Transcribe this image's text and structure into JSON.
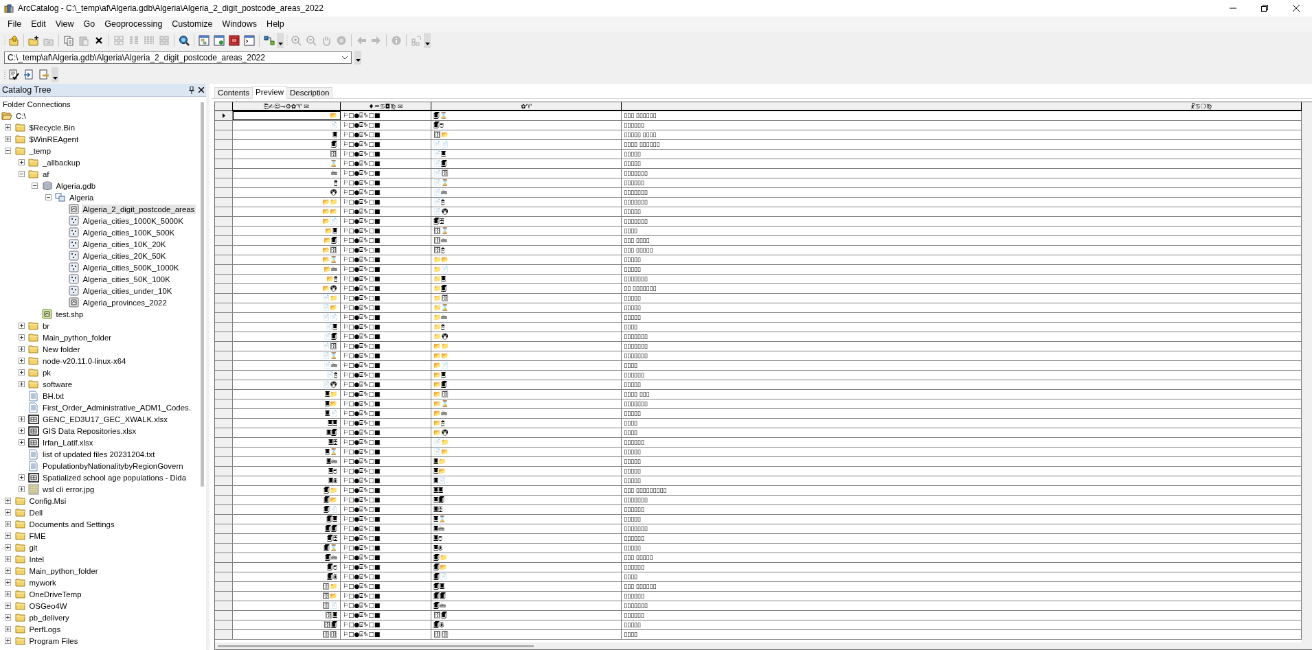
{
  "window": {
    "title": "ArcCatalog - C:\\_temp\\af\\Algeria.gdb\\Algeria\\Algeria_2_digit_postcode_areas_2022"
  },
  "menu": [
    "File",
    "Edit",
    "View",
    "Go",
    "Geoprocessing",
    "Customize",
    "Windows",
    "Help"
  ],
  "location": {
    "value": "C:\\_temp\\af\\Algeria.gdb\\Algeria\\Algeria_2_digit_postcode_areas_2022"
  },
  "catalog_tree": {
    "title": "Catalog Tree",
    "items": [
      {
        "label": "Folder Connections",
        "kind": "connections",
        "selected": false
      },
      {
        "label": "C:\\",
        "kind": "drive",
        "selected": false,
        "children": [
          {
            "label": "$Recycle.Bin",
            "kind": "folder",
            "expanded": false,
            "selected": false
          },
          {
            "label": "$WinREAgent",
            "kind": "folder",
            "expanded": false,
            "selected": false
          },
          {
            "label": "_temp",
            "kind": "folder",
            "expanded": true,
            "selected": false,
            "children": [
              {
                "label": "_allbackup",
                "kind": "folder",
                "expanded": false,
                "selected": false
              },
              {
                "label": "af",
                "kind": "folder",
                "expanded": true,
                "selected": false,
                "children": [
                  {
                    "label": "Algeria.gdb",
                    "kind": "geodatabase",
                    "expanded": true,
                    "selected": false,
                    "children": [
                      {
                        "label": "Algeria",
                        "kind": "dataset",
                        "expanded": true,
                        "selected": false,
                        "children": [
                          {
                            "label": "Algeria_2_digit_postcode_areas",
                            "kind": "polygon",
                            "selected": true
                          },
                          {
                            "label": "Algeria_cities_1000K_5000K",
                            "kind": "point",
                            "selected": false
                          },
                          {
                            "label": "Algeria_cities_100K_500K",
                            "kind": "point",
                            "selected": false
                          },
                          {
                            "label": "Algeria_cities_10K_20K",
                            "kind": "point",
                            "selected": false
                          },
                          {
                            "label": "Algeria_cities_20K_50K",
                            "kind": "point",
                            "selected": false
                          },
                          {
                            "label": "Algeria_cities_500K_1000K",
                            "kind": "point",
                            "selected": false
                          },
                          {
                            "label": "Algeria_cities_50K_100K",
                            "kind": "point",
                            "selected": false
                          },
                          {
                            "label": "Algeria_cities_under_10K",
                            "kind": "point",
                            "selected": false
                          },
                          {
                            "label": "Algeria_provinces_2022",
                            "kind": "polygon",
                            "selected": false
                          }
                        ]
                      }
                    ]
                  },
                  {
                    "label": "test.shp",
                    "kind": "shapefile",
                    "selected": false
                  }
                ]
              },
              {
                "label": "br",
                "kind": "folder",
                "expanded": false,
                "selected": false
              },
              {
                "label": "Main_python_folder",
                "kind": "folder",
                "expanded": false,
                "selected": false
              },
              {
                "label": "New folder",
                "kind": "folder",
                "expanded": false,
                "selected": false
              },
              {
                "label": "node-v20.11.0-linux-x64",
                "kind": "folder",
                "expanded": false,
                "selected": false
              },
              {
                "label": "pk",
                "kind": "folder",
                "expanded": false,
                "selected": false
              },
              {
                "label": "software",
                "kind": "folder",
                "expanded": false,
                "selected": false
              },
              {
                "label": "BH.txt",
                "kind": "text",
                "selected": false
              },
              {
                "label": "First_Order_Administrative_ADM1_Codes.",
                "kind": "text",
                "selected": false
              },
              {
                "label": "GENC_ED3U17_GEC_XWALK.xlsx",
                "kind": "table",
                "expanded": false,
                "selected": false
              },
              {
                "label": "GIS Data Repositories.xlsx",
                "kind": "table",
                "expanded": false,
                "selected": false
              },
              {
                "label": "Irfan_Latif.xlsx",
                "kind": "table",
                "expanded": false,
                "selected": false
              },
              {
                "label": "list of updated files 20231204.txt",
                "kind": "text",
                "selected": false
              },
              {
                "label": "PopulationbyNationalitybyRegionGovern",
                "kind": "text",
                "selected": false
              },
              {
                "label": "Spatialized school age populations - Dida",
                "kind": "table",
                "expanded": false,
                "selected": false
              },
              {
                "label": "wsl cli error.jpg",
                "kind": "raster",
                "expanded": false,
                "selected": false
              }
            ]
          },
          {
            "label": "Config.Msi",
            "kind": "folder",
            "expanded": false,
            "selected": false
          },
          {
            "label": "Dell",
            "kind": "folder",
            "expanded": false,
            "selected": false
          },
          {
            "label": "Documents and Settings",
            "kind": "folder",
            "expanded": false,
            "selected": false
          },
          {
            "label": "FME",
            "kind": "folder",
            "expanded": false,
            "selected": false
          },
          {
            "label": "git",
            "kind": "folder",
            "expanded": false,
            "selected": false
          },
          {
            "label": "Intel",
            "kind": "folder",
            "expanded": false,
            "selected": false
          },
          {
            "label": "Main_python_folder",
            "kind": "folder",
            "expanded": false,
            "selected": false
          },
          {
            "label": "mywork",
            "kind": "folder",
            "expanded": false,
            "selected": false
          },
          {
            "label": "OneDriveTemp",
            "kind": "folder",
            "expanded": false,
            "selected": false
          },
          {
            "label": "OSGeo4W",
            "kind": "folder",
            "expanded": false,
            "selected": false
          },
          {
            "label": "pb_delivery",
            "kind": "folder",
            "expanded": false,
            "selected": false
          },
          {
            "label": "PerfLogs",
            "kind": "folder",
            "expanded": false,
            "selected": false
          },
          {
            "label": "Program Files",
            "kind": "folder",
            "expanded": false,
            "selected": false
          }
        ]
      }
    ]
  },
  "tabs": [
    {
      "label": "Contents",
      "selected": false
    },
    {
      "label": "Preview",
      "selected": true
    },
    {
      "label": "Description",
      "selected": false
    }
  ],
  "table": {
    "columns": [
      "⎘✍☺⊸⚙✿♈   ✉",
      "♦♒♋◘♍   ✉",
      "✿♈",
      "☧♋❍♍"
    ],
    "rows": [
      {
        "current": true,
        "cells": [
          "📂",
          "⚐□●⍓♑□■",
          "🗐⌛",
          "▯▯▯ ▯▯▯▯▯▯"
        ]
      },
      {
        "current": false,
        "cells": [
          "📄",
          "⚐□●⍓♑□■",
          "🗐🖰",
          "▯▯▯▯▯▯"
        ]
      },
      {
        "current": false,
        "cells": [
          "🗏",
          "⚐□●⍓♑□■",
          "🗄📂",
          "▯▯▯▯▯ ▯▯▯▯"
        ]
      },
      {
        "current": false,
        "cells": [
          "🗐",
          "⚐□●⍓♑□■",
          "📄📄",
          "▯▯▯▯ ▯▯▯▯▯▯"
        ]
      },
      {
        "current": false,
        "cells": [
          "🗄",
          "⚐□●⍓♑□■",
          "📄🗏",
          "▯▯▯▯▯"
        ]
      },
      {
        "current": false,
        "cells": [
          "⌛",
          "⚐□●⍓♑□■",
          "📄🗐",
          "▯▯▯▯▯"
        ]
      },
      {
        "current": false,
        "cells": [
          "🖮",
          "⚐□●⍓♑□■",
          "📄🗄",
          "▯▯▯▯▯▯▯"
        ]
      },
      {
        "current": false,
        "cells": [
          "🖰",
          "⚐□●⍓♑□■",
          "📄⌛",
          "▯▯▯▯▯▯"
        ]
      },
      {
        "current": false,
        "cells": [
          "🖲",
          "⚐□●⍓♑□■",
          "📄🖮",
          "▯▯▯▯▯▯▯"
        ]
      },
      {
        "current": false,
        "cells": [
          "📂📁",
          "⚐□●⍓♑□■",
          "📄🖰",
          "▯▯▯▯▯▯▯"
        ]
      },
      {
        "current": false,
        "cells": [
          "📂📂",
          "⚐□●⍓♑□■",
          "📄🖲",
          "▯▯▯▯▯"
        ]
      },
      {
        "current": false,
        "cells": [
          "📂📄",
          "⚐□●⍓♑□■",
          "🗐🗄",
          "▯▯▯▯▯▯▯"
        ]
      },
      {
        "current": false,
        "cells": [
          "📂🗏",
          "⚐□●⍓♑□■",
          "🗄⌛",
          "▯▯▯▯"
        ]
      },
      {
        "current": false,
        "cells": [
          "📂🗐",
          "⚐□●⍓♑□■",
          "🗄🖮",
          "▯▯▯ ▯▯▯▯"
        ]
      },
      {
        "current": false,
        "cells": [
          "📂🗄",
          "⚐□●⍓♑□■",
          "🗄🖰",
          "▯▯▯ ▯▯▯▯▯"
        ]
      },
      {
        "current": false,
        "cells": [
          "📂⌛",
          "⚐□●⍓♑□■",
          "📁📂",
          "▯▯▯▯▯"
        ]
      },
      {
        "current": false,
        "cells": [
          "📂🖮",
          "⚐□●⍓♑□■",
          "📁📄",
          "▯▯▯▯▯"
        ]
      },
      {
        "current": false,
        "cells": [
          "📂🖰",
          "⚐□●⍓♑□■",
          "📁🗏",
          "▯▯▯▯▯▯▯"
        ]
      },
      {
        "current": false,
        "cells": [
          "📂🖲",
          "⚐□●⍓♑□■",
          "📁🗐",
          "▯▯ ▯▯▯▯▯▯▯"
        ]
      },
      {
        "current": false,
        "cells": [
          "📄📁",
          "⚐□●⍓♑□■",
          "📁🗄",
          "▯▯▯▯▯"
        ]
      },
      {
        "current": false,
        "cells": [
          "📄📂",
          "⚐□●⍓♑□■",
          "📁⌛",
          "▯▯▯▯▯"
        ]
      },
      {
        "current": false,
        "cells": [
          "📄📄",
          "⚐□●⍓♑□■",
          "📁🖮",
          "▯▯▯▯▯"
        ]
      },
      {
        "current": false,
        "cells": [
          "📄🗏",
          "⚐□●⍓♑□■",
          "📁🖰",
          "▯▯▯▯"
        ]
      },
      {
        "current": false,
        "cells": [
          "📄🗐",
          "⚐□●⍓♑□■",
          "📁🖲",
          "▯▯▯▯▯▯▯"
        ]
      },
      {
        "current": false,
        "cells": [
          "📄🗄",
          "⚐□●⍓♑□■",
          "📂📁",
          "▯▯▯▯▯▯▯"
        ]
      },
      {
        "current": false,
        "cells": [
          "📄⌛",
          "⚐□●⍓♑□■",
          "📂📂",
          "▯▯▯▯▯▯▯"
        ]
      },
      {
        "current": false,
        "cells": [
          "📄🖮",
          "⚐□●⍓♑□■",
          "📂📄",
          "▯▯▯▯"
        ]
      },
      {
        "current": false,
        "cells": [
          "📄🖰",
          "⚐□●⍓♑□■",
          "📂🗏",
          "▯▯▯▯▯▯"
        ]
      },
      {
        "current": false,
        "cells": [
          "📄🖲",
          "⚐□●⍓♑□■",
          "📂🗐",
          "▯▯▯▯▯"
        ]
      },
      {
        "current": false,
        "cells": [
          "🗏📁",
          "⚐□●⍓♑□■",
          "📂🗄",
          "▯▯▯▯ ▯▯▯"
        ]
      },
      {
        "current": false,
        "cells": [
          "🗏📂",
          "⚐□●⍓♑□■",
          "📂⌛",
          "▯▯▯▯▯▯▯"
        ]
      },
      {
        "current": false,
        "cells": [
          "🗏📄",
          "⚐□●⍓♑□■",
          "📂🖮",
          "▯▯▯▯▯"
        ]
      },
      {
        "current": false,
        "cells": [
          "🗏🗏",
          "⚐□●⍓♑□■",
          "📂🖰",
          "▯▯▯▯"
        ]
      },
      {
        "current": false,
        "cells": [
          "🗏🗐",
          "⚐□●⍓♑□■",
          "📂🖲",
          "▯▯▯▯"
        ]
      },
      {
        "current": false,
        "cells": [
          "🗏🗄",
          "⚐□●⍓♑□■",
          "📄📁",
          "▯▯▯▯▯▯"
        ]
      },
      {
        "current": false,
        "cells": [
          "🗏⌛",
          "⚐□●⍓♑□■",
          "📄📂",
          "▯▯▯▯▯"
        ]
      },
      {
        "current": false,
        "cells": [
          "🗏🖮",
          "⚐□●⍓♑□■",
          "🗏📁",
          "▯▯▯▯▯"
        ]
      },
      {
        "current": false,
        "cells": [
          "🗏🖰",
          "⚐□●⍓♑□■",
          "🗏📂",
          "▯▯▯▯▯"
        ]
      },
      {
        "current": false,
        "cells": [
          "🗏🖲",
          "⚐□●⍓♑□■",
          "🗏📄",
          "▯▯▯▯▯"
        ]
      },
      {
        "current": false,
        "cells": [
          "🗐📁",
          "⚐□●⍓♑□■",
          "🗏🗏",
          "▯▯▯ ▯▯▯▯▯▯▯▯▯"
        ]
      },
      {
        "current": false,
        "cells": [
          "🗐📂",
          "⚐□●⍓♑□■",
          "🗏🗐",
          "▯▯▯▯▯▯▯"
        ]
      },
      {
        "current": false,
        "cells": [
          "🗐📄",
          "⚐□●⍓♑□■",
          "🗏🗄",
          "▯▯▯▯▯▯"
        ]
      },
      {
        "current": false,
        "cells": [
          "🗐🗏",
          "⚐□●⍓♑□■",
          "🗏⌛",
          "▯▯▯▯▯"
        ]
      },
      {
        "current": false,
        "cells": [
          "🗐🗐",
          "⚐□●⍓♑□■",
          "🗏🖮",
          "▯▯▯▯▯▯▯"
        ]
      },
      {
        "current": false,
        "cells": [
          "🗐🗄",
          "⚐□●⍓♑□■",
          "🗏🖰",
          "▯▯▯▯▯▯"
        ]
      },
      {
        "current": false,
        "cells": [
          "🗐⌛",
          "⚐□●⍓♑□■",
          "🗏🖲",
          "▯▯▯▯▯"
        ]
      },
      {
        "current": false,
        "cells": [
          "🗐🖮",
          "⚐□●⍓♑□■",
          "🗐📁",
          "▯▯▯ ▯▯▯▯▯"
        ]
      },
      {
        "current": false,
        "cells": [
          "🗐🖰",
          "⚐□●⍓♑□■",
          "🗐📂",
          "▯▯▯▯▯▯"
        ]
      },
      {
        "current": false,
        "cells": [
          "🗐🖲",
          "⚐□●⍓♑□■",
          "🗐📄",
          "▯▯▯▯"
        ]
      },
      {
        "current": false,
        "cells": [
          "🗄📁",
          "⚐□●⍓♑□■",
          "🗐🗏",
          "▯▯▯ ▯▯▯▯▯▯"
        ]
      },
      {
        "current": false,
        "cells": [
          "🗄📂",
          "⚐□●⍓♑□■",
          "🗐🗐",
          "▯▯▯▯▯▯"
        ]
      },
      {
        "current": false,
        "cells": [
          "🗄📄",
          "⚐□●⍓♑□■",
          "🗐🖮",
          "▯▯▯▯▯▯▯"
        ]
      },
      {
        "current": false,
        "cells": [
          "🗄🗏",
          "⚐□●⍓♑□■",
          "🗄🗐",
          "▯▯▯▯▯▯"
        ]
      },
      {
        "current": false,
        "cells": [
          "🗄🗐",
          "⚐□●⍓♑□■",
          "🗐🖲",
          "▯▯▯▯▯"
        ]
      },
      {
        "current": false,
        "cells": [
          "🗄🗄",
          "⚐□●⍓♑□■",
          "🗄🗄",
          "▯▯▯▯"
        ]
      }
    ]
  }
}
